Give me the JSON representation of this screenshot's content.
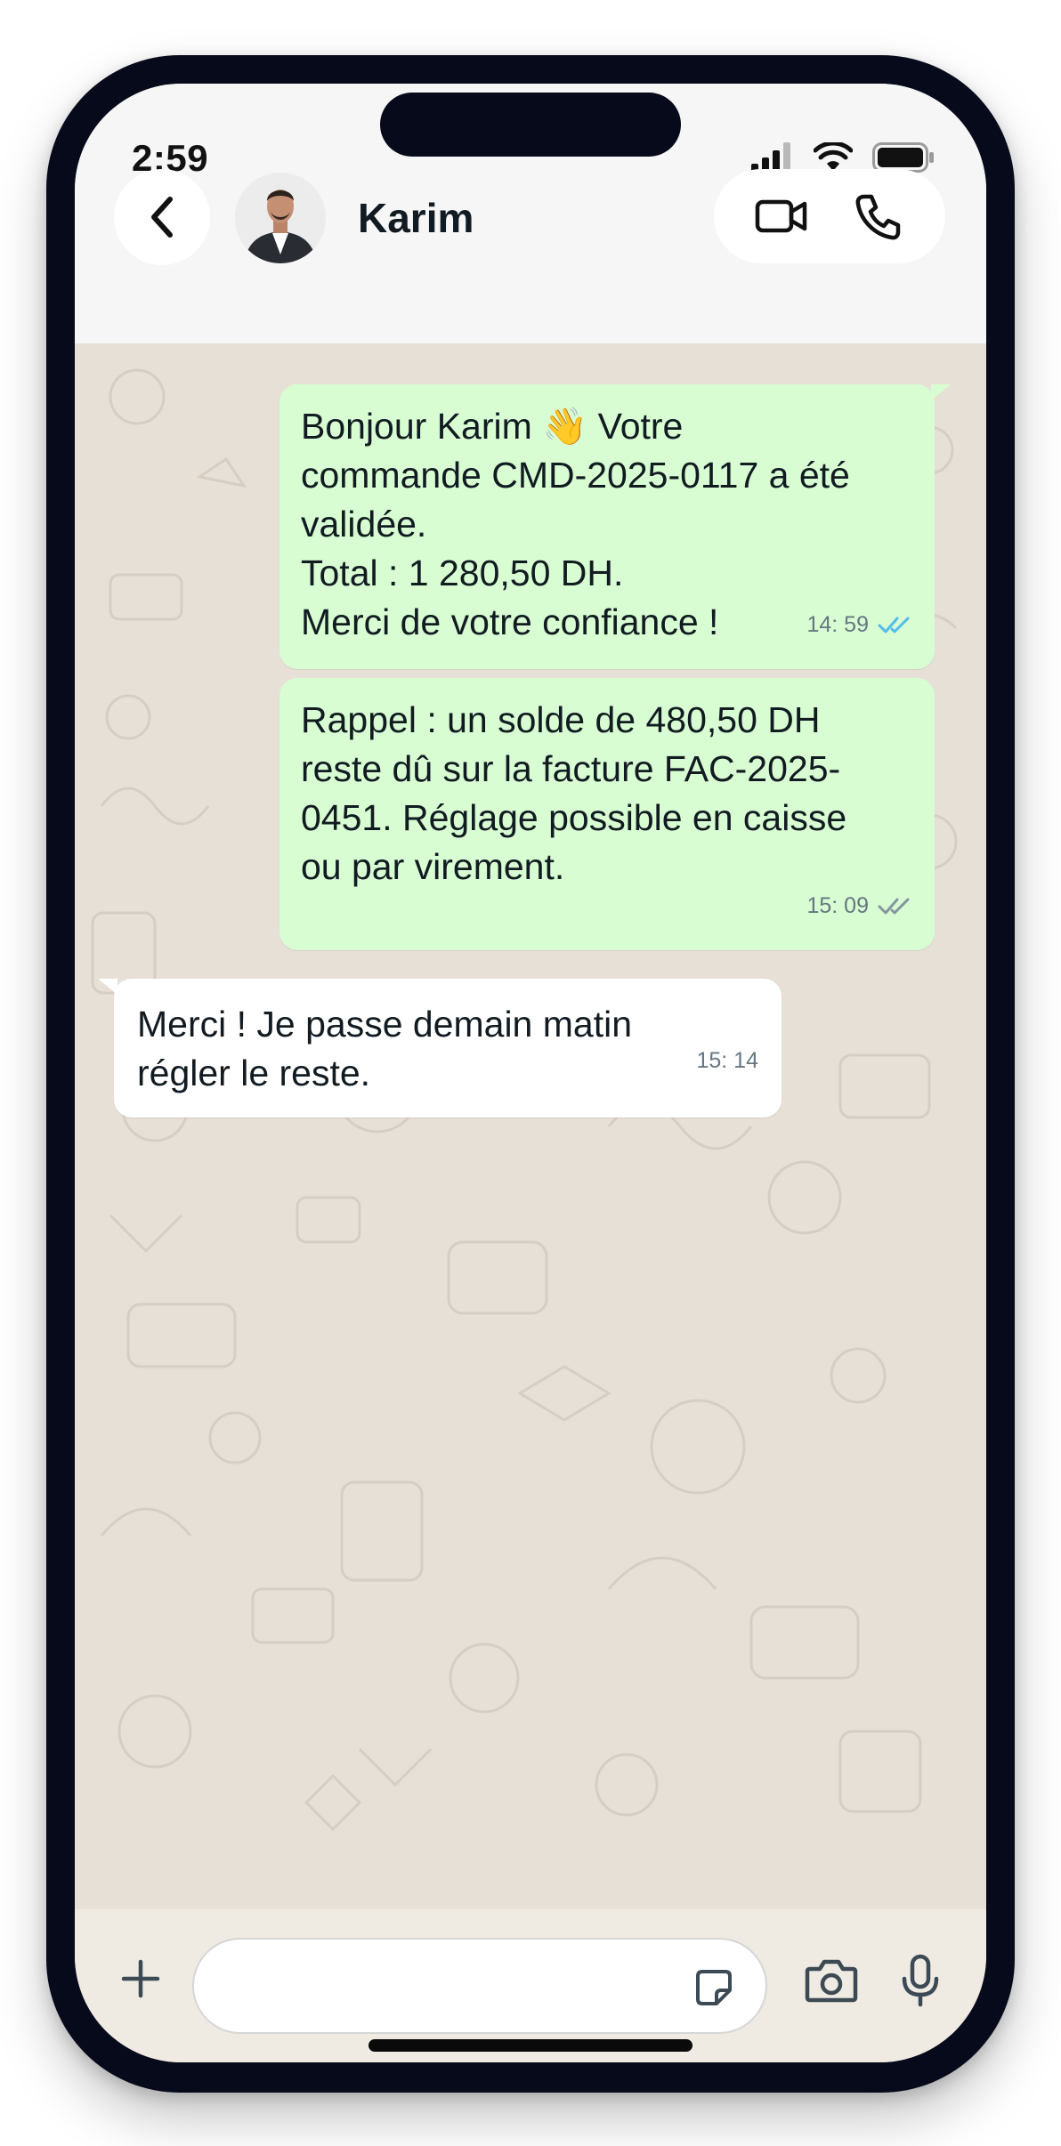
{
  "status_bar": {
    "time": "2:59"
  },
  "header": {
    "contact_name": "Karim",
    "back_icon": "chevron-left-icon",
    "video_icon": "video-camera-icon",
    "call_icon": "phone-icon"
  },
  "messages": [
    {
      "direction": "outgoing",
      "text": "Bonjour Karim 👋 Votre\ncommande CMD-2025-0117 a été\nvalidée.\nTotal : 1 280,50 DH.\nMerci de votre confiance !",
      "time": "14: 59",
      "status": "read",
      "status_color": "#53bdeb"
    },
    {
      "direction": "outgoing",
      "text": "Rappel : un solde de 480,50 DH\nreste dû sur la facture FAC-2025-\n0451. Réglage possible en caisse\nou par virement.",
      "time": "15: 09",
      "status": "delivered",
      "status_color": "#8696a0"
    },
    {
      "direction": "incoming",
      "text": "Merci ! Je passe demain matin\nrégler le reste.",
      "time": "15: 14"
    }
  ],
  "composer": {
    "value": "",
    "placeholder": "",
    "icons": [
      "plus-icon",
      "sticker-icon",
      "camera-icon",
      "microphone-icon"
    ]
  },
  "colors": {
    "outgoing_bubble": "#d8fdd2",
    "incoming_bubble": "#ffffff",
    "chat_background": "#e7e0d7"
  }
}
